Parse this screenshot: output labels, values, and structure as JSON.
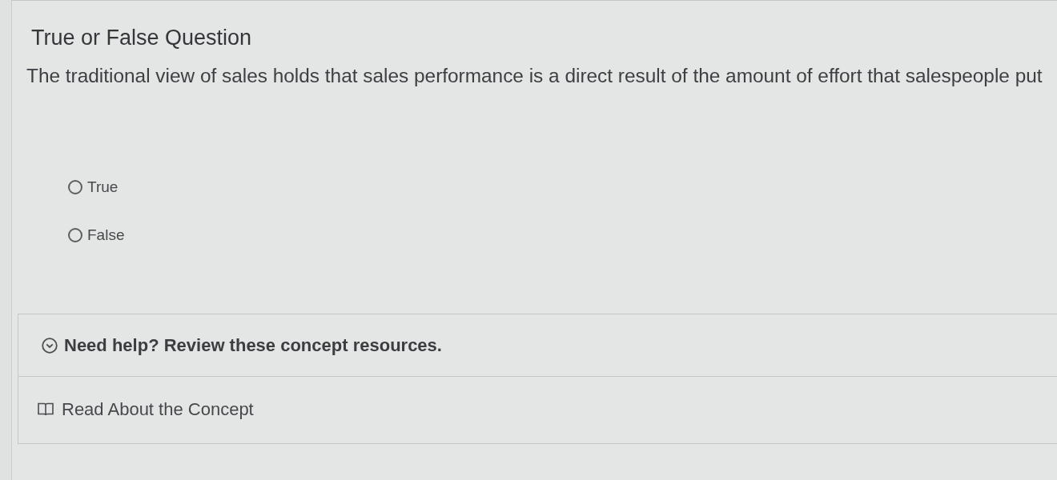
{
  "title": "True or False Question",
  "question": "The traditional view of sales holds that sales performance is a direct result of the amount of effort that salespeople put",
  "options": [
    {
      "label": "True",
      "selected": false
    },
    {
      "label": "False",
      "selected": false
    }
  ],
  "help": {
    "heading": "Need help? Review these concept resources.",
    "expanded": true,
    "resources": [
      {
        "label": "Read About the Concept"
      }
    ]
  }
}
